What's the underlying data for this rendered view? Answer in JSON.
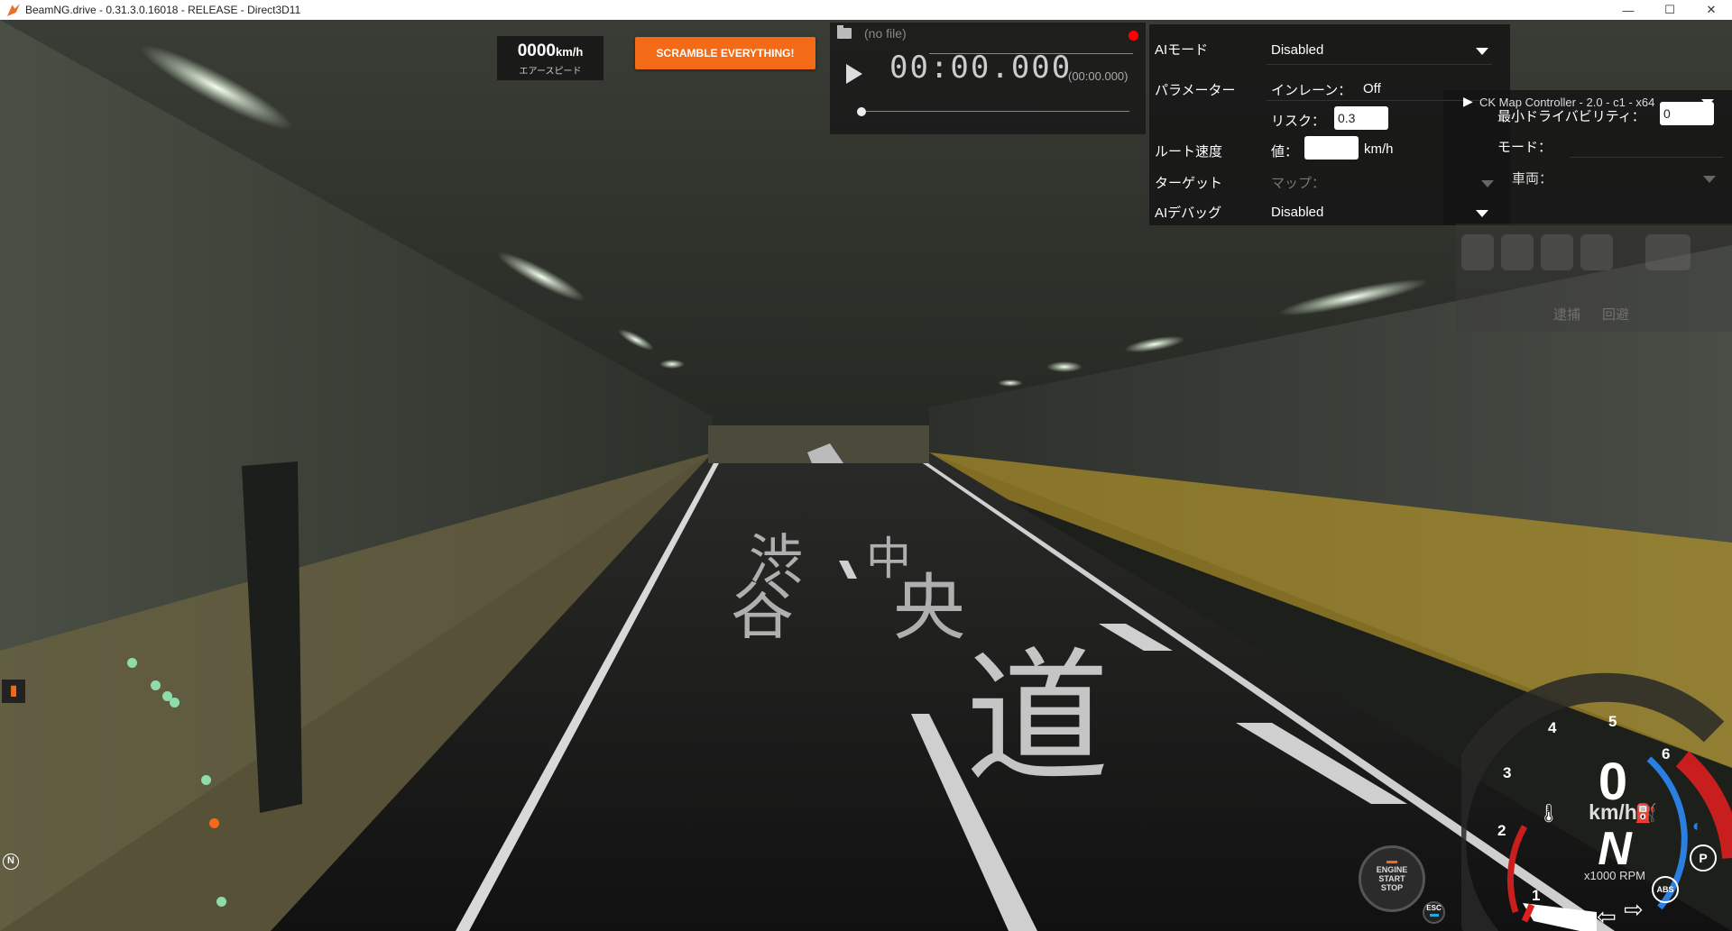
{
  "window": {
    "title": "BeamNG.drive - 0.31.3.0.16018 - RELEASE - Direct3D11",
    "minimize": "—",
    "maximize": "☐",
    "close": "✕"
  },
  "airspeed": {
    "value": "0000",
    "unit": "km/h",
    "caption": "エアースピード"
  },
  "scramble_button": "SCRAMBLE EVERYTHING!",
  "replay": {
    "file": "(no file)",
    "time": "00:00.000",
    "subtime": "(00:00.000)",
    "recording_color": "#ff0000"
  },
  "ai": {
    "mode_label": "AIモード",
    "mode_value": "Disabled",
    "params_label": "パラメーター",
    "inlane_label": "インレーン：",
    "inlane_value": "Off",
    "risk_label": "リスク：",
    "risk_value": "0.3",
    "min_drivability_label": "最小ドライバビリティ：",
    "min_drivability_value": "0",
    "route_speed_label": "ルート速度",
    "value_label": "値：",
    "value_value": "",
    "value_unit": "km/h",
    "mode2_label": "モード：",
    "target_label": "ターゲット",
    "map_label": "マップ：",
    "vehicle_label": "車両：",
    "debug_label": "AIデバッグ",
    "debug_value": "Disabled"
  },
  "mod_controller": {
    "label": "CK Map Controller - 2.0 - c1 - x64"
  },
  "faded_panel": {
    "left_label": "逮捕",
    "right_label": "回避"
  },
  "map_icon": "map-icon",
  "compass": "N",
  "engine_button": {
    "line1": "ENGINE",
    "line2": "START",
    "line3": "STOP"
  },
  "esc_button": "ESC",
  "dashboard": {
    "speed": "0",
    "speed_unit": "km/h",
    "gear": "N",
    "rpm_unit": "x1000 RPM",
    "ticks": [
      "1",
      "2",
      "3",
      "4",
      "5",
      "6"
    ],
    "parking": "P",
    "abs": "ABS",
    "redline_color": "#c81e1e",
    "accent_color": "#2a7fe0"
  },
  "accent": "#f36b16"
}
